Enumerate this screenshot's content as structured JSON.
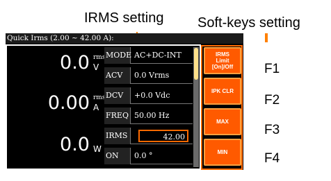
{
  "annotations": {
    "irms_setting": "IRMS setting",
    "softkeys_setting": "Soft-keys setting",
    "f1": "F1",
    "f2": "F2",
    "f3": "F3",
    "f4": "F4"
  },
  "screen": {
    "title": "Quick Irms (2.00 ~ 42.00 A):",
    "measurements": [
      {
        "value": "0.0",
        "superscript": "rms",
        "unit": "V"
      },
      {
        "value": "0.00",
        "superscript": "rms",
        "unit": "A"
      },
      {
        "value": "0.0",
        "superscript": "",
        "unit": "W"
      }
    ],
    "parameters": [
      {
        "label": "MODE",
        "value": "AC+DC-INT"
      },
      {
        "label": "ACV",
        "value": "0.0 Vrms"
      },
      {
        "label": "DCV",
        "value": "+0.0 Vdc"
      },
      {
        "label": "FREQ",
        "value": "50.00 Hz"
      },
      {
        "label": "IRMS",
        "value": "42.00"
      },
      {
        "label": "ON Phs",
        "value": "0.0 °"
      }
    ],
    "softkeys": [
      {
        "label": "IRMS Limit [On]/Off"
      },
      {
        "label": "IPK CLR"
      },
      {
        "label": "MAX"
      },
      {
        "label": "MIN"
      }
    ]
  },
  "colors": {
    "highlight": "#ff6a00",
    "softkey": "#ff5a00",
    "screen_bg": "#000000"
  }
}
